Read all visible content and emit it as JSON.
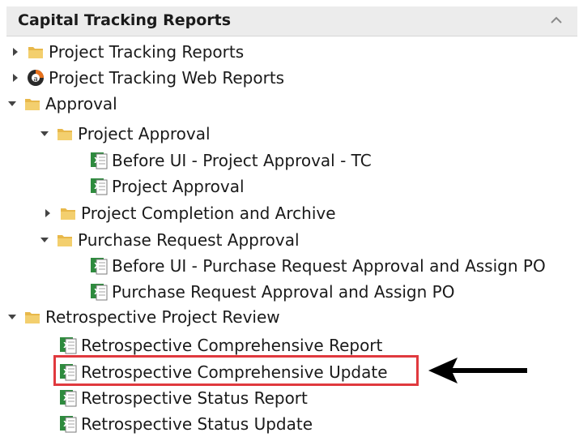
{
  "panel": {
    "title": "Capital Tracking Reports",
    "collapse_icon": "chevron-up-icon"
  },
  "tree": {
    "project_tracking_reports": "Project Tracking Reports",
    "project_tracking_web_reports": "Project Tracking Web Reports",
    "approval": "Approval",
    "project_approval": "Project Approval",
    "before_ui_project_approval_tc": "Before UI - Project Approval - TC",
    "project_approval_report": "Project Approval",
    "project_completion_archive": "Project Completion and Archive",
    "purchase_request_approval": "Purchase Request Approval",
    "before_ui_pr_approval_assign_po": "Before UI - Purchase Request Approval and Assign PO",
    "pr_approval_assign_po": "Purchase Request Approval and Assign PO",
    "retrospective_project_review": "Retrospective Project Review",
    "retro_comprehensive_report": "Retrospective Comprehensive Report",
    "retro_comprehensive_update": "Retrospective Comprehensive Update",
    "retro_status_report": "Retrospective Status Report",
    "retro_status_update": "Retrospective Status Update"
  },
  "colors": {
    "highlight_border": "#e0393e",
    "folder": "#e8b84a",
    "excel_green": "#2e8b3e"
  }
}
